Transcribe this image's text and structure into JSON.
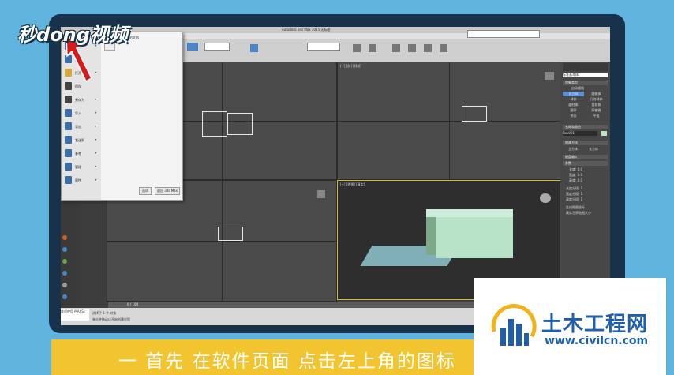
{
  "window": {
    "title": "Autodesk 3ds Max 2015  无标题"
  },
  "app_menu": {
    "recent_label": "最近使用的文档",
    "items": [
      {
        "label": "新建",
        "has_submenu": true
      },
      {
        "label": "重置",
        "has_submenu": false
      },
      {
        "label": "打开",
        "has_submenu": true
      },
      {
        "label": "保存",
        "has_submenu": false
      },
      {
        "label": "另存为",
        "has_submenu": true
      },
      {
        "label": "导入",
        "has_submenu": true
      },
      {
        "label": "导出",
        "has_submenu": true
      },
      {
        "label": "发送到",
        "has_submenu": true
      },
      {
        "label": "参考",
        "has_submenu": true
      },
      {
        "label": "管理",
        "has_submenu": true
      },
      {
        "label": "属性",
        "has_submenu": true
      }
    ],
    "options_button": "选项",
    "exit_button": "退出 3ds Max"
  },
  "viewports": {
    "top": "[+] [顶] [线框]",
    "front": "[+] [前] [线框]",
    "left": "[+] [左] [线框]",
    "perspective": "[+] [透视] [真实]"
  },
  "command_panel": {
    "category": "标准基本体",
    "rollout_object_type": "对象类型",
    "autogrid": "自动栅格",
    "buttons": [
      "长方体",
      "圆锥体",
      "球体",
      "几何球体",
      "圆柱体",
      "管状体",
      "圆环",
      "四棱锥",
      "茶壶",
      "平面"
    ],
    "rollout_name_color": "名称和颜色",
    "object_name": "Box001",
    "rollout_creation_method": "创建方法",
    "creation_options": [
      "立方体",
      "长方体"
    ],
    "rollout_keyboard": "键盘输入",
    "rollout_params": "参数",
    "params": [
      {
        "label": "长度:",
        "value": "0.0"
      },
      {
        "label": "宽度:",
        "value": "0.0"
      },
      {
        "label": "高度:",
        "value": "0.0"
      },
      {
        "label": "长度分段:",
        "value": "1"
      },
      {
        "label": "宽度分段:",
        "value": "1"
      },
      {
        "label": "高度分段:",
        "value": "1"
      }
    ],
    "gen_mapping": "生成贴图坐标",
    "real_world": "真实世界贴图大小"
  },
  "timeline": {
    "frame": "0 / 100"
  },
  "status": {
    "selection": "选择了 1 个 对象",
    "hint": "单击并拖动以开始创建过程",
    "maxscript": "欢迎使用 MAXSc"
  },
  "caption": {
    "text": "一 首先 在软件页面 点击左上角的图标"
  },
  "logos": {
    "miaodong": "秒dong视频",
    "tumu_title": "土木工程网",
    "tumu_url": "www.civilcn.com"
  },
  "colors": {
    "background": "#5fb3dc",
    "caption_bar": "#f2c430",
    "logo_blue": "#1f5fae",
    "box_green": "#b8e3c8"
  }
}
